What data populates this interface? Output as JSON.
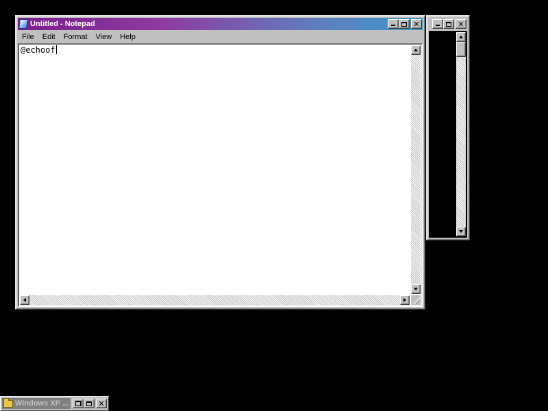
{
  "notepad": {
    "title": "Untitled - Notepad",
    "menu": [
      "File",
      "Edit",
      "Format",
      "View",
      "Help"
    ],
    "text": "@echoof"
  },
  "minimized_window": {
    "title": "Windows XP ..."
  },
  "colors": {
    "titlebar_active_start": "#7b1e8c",
    "titlebar_active_end": "#3a98c8",
    "window_face": "#c0c0c0",
    "desktop": "#000000"
  },
  "icons": {
    "notepad": "notepad-icon",
    "folder": "folder-icon"
  }
}
